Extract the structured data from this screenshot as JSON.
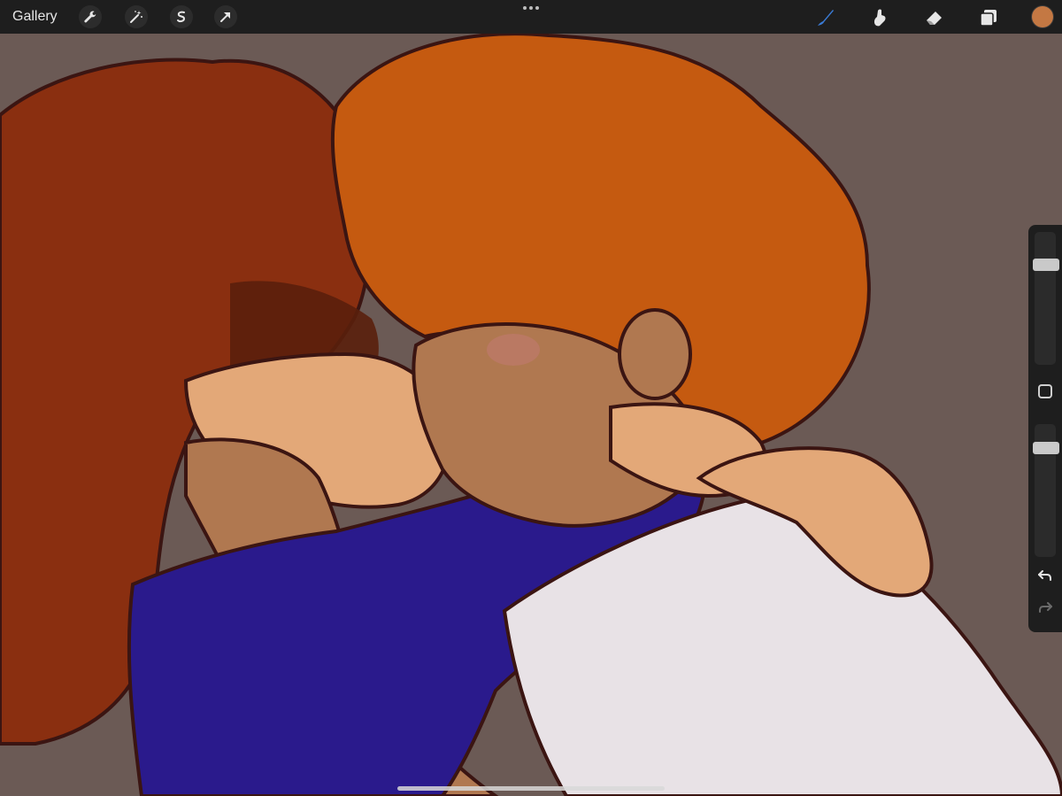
{
  "toolbar": {
    "gallery_label": "Gallery",
    "left_tools": [
      {
        "icon": "wrench-icon",
        "name": "actions"
      },
      {
        "icon": "magic-wand-icon",
        "name": "adjustments"
      },
      {
        "icon": "selection-icon",
        "name": "selection"
      },
      {
        "icon": "arrow-cursor-icon",
        "name": "transform"
      }
    ],
    "more_icon": "ellipsis-icon",
    "right_tools": [
      {
        "icon": "brush-icon",
        "name": "paint",
        "active": true
      },
      {
        "icon": "smudge-icon",
        "name": "smudge",
        "active": false
      },
      {
        "icon": "eraser-icon",
        "name": "erase",
        "active": false
      },
      {
        "icon": "layers-icon",
        "name": "layers",
        "active": false
      }
    ],
    "current_color": "#c47843"
  },
  "sidebar": {
    "brush_size_level": 0.78,
    "opacity_level": 0.85,
    "modify_icon": "square-icon",
    "undo_icon": "undo-icon",
    "redo_icon": "redo-icon"
  },
  "colors": {
    "background": "#6b5a55",
    "toolbar": "#1e1e1e",
    "active_tool": "#3a7bd5",
    "hair_left": "#8a2f10",
    "hair_right": "#c55a10",
    "shirt": "#2a1a8c",
    "skin_dark": "#b07850",
    "skin_light": "#e3a878",
    "sleeve_white": "#e8e2e6",
    "lineart": "#3b1512"
  }
}
